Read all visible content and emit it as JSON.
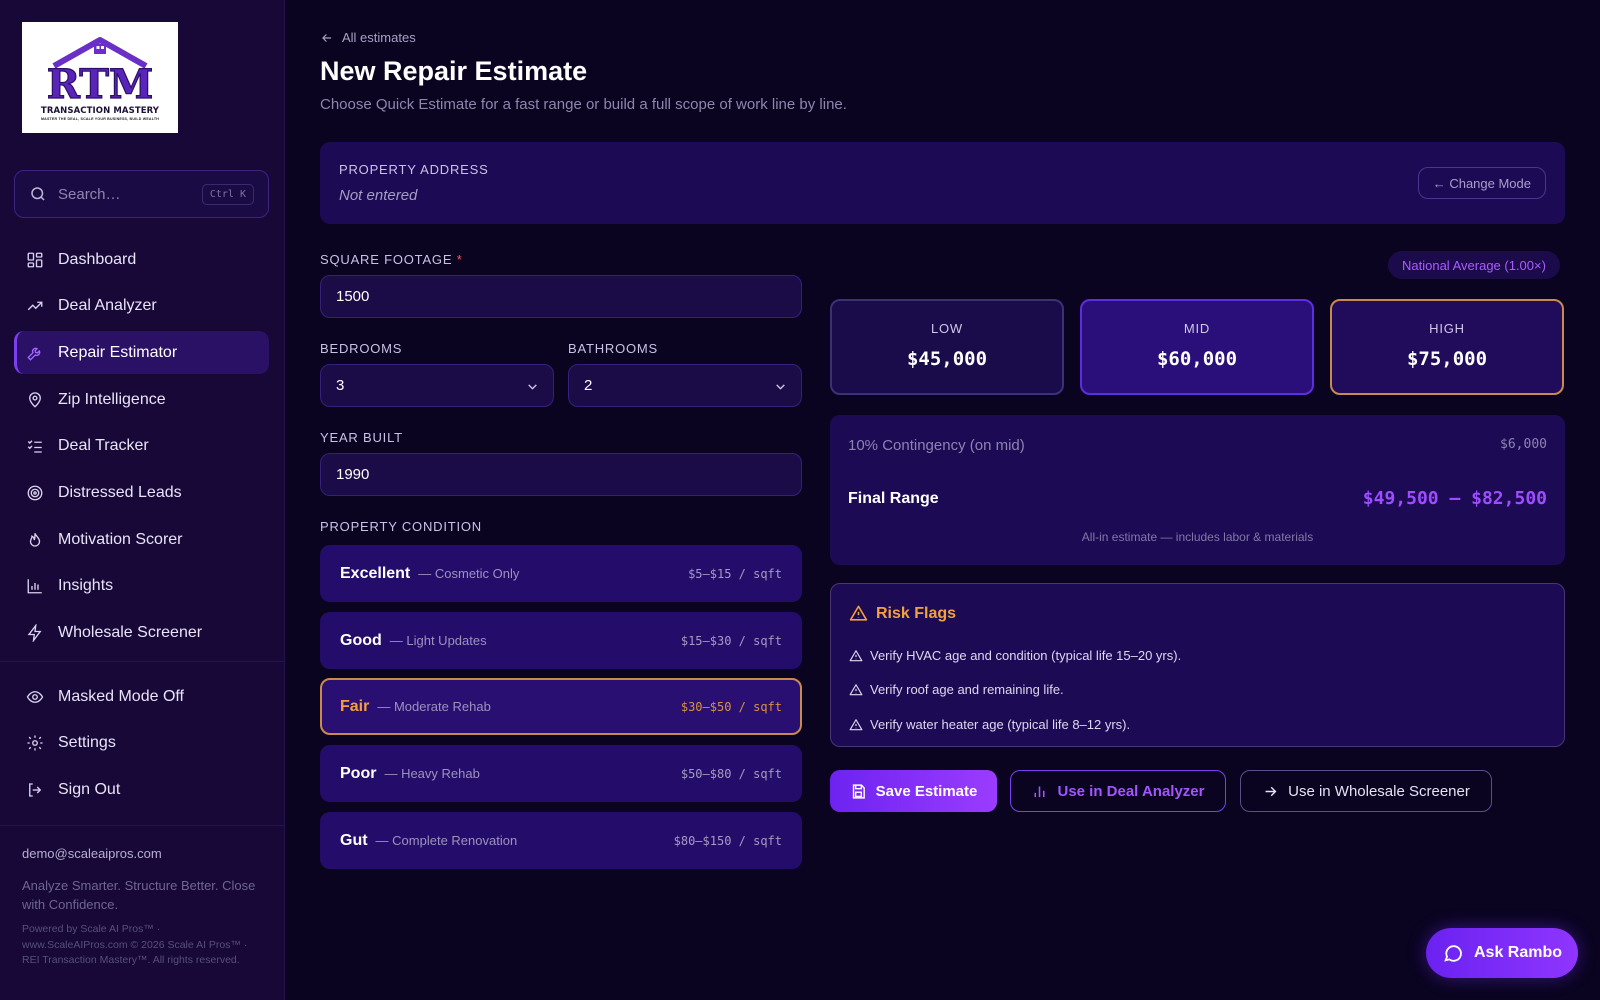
{
  "brand": {
    "logo_letters": "RTM",
    "logo_title": "TRANSACTION MASTERY",
    "logo_tagline": "MASTER THE DEAL, SCALE YOUR BUSINESS, BUILD WEALTH"
  },
  "search": {
    "placeholder": "Search…",
    "shortcut": "Ctrl K"
  },
  "sidebar": {
    "items": [
      {
        "label": "Dashboard",
        "icon": "grid-icon"
      },
      {
        "label": "Deal Analyzer",
        "icon": "trending-up-icon"
      },
      {
        "label": "Repair Estimator",
        "icon": "wrench-icon",
        "active": true
      },
      {
        "label": "Zip Intelligence",
        "icon": "map-pin-icon"
      },
      {
        "label": "Deal Tracker",
        "icon": "checklist-icon"
      },
      {
        "label": "Distressed Leads",
        "icon": "target-icon"
      },
      {
        "label": "Motivation Scorer",
        "icon": "flame-icon"
      },
      {
        "label": "Insights",
        "icon": "bar-chart-icon"
      },
      {
        "label": "Wholesale Screener",
        "icon": "lightning-icon"
      }
    ],
    "secondary": [
      {
        "label": "Masked Mode Off",
        "icon": "eye-icon"
      },
      {
        "label": "Settings",
        "icon": "gear-icon"
      },
      {
        "label": "Sign Out",
        "icon": "sign-out-icon"
      }
    ],
    "email": "demo@scaleaipros.com",
    "tagline": "Analyze Smarter. Structure Better. Close with Confidence.",
    "footer": "Powered by Scale AI Pros™ · www.ScaleAIPros.com © 2026 Scale AI Pros™ · REI Transaction Mastery™. All rights reserved."
  },
  "header": {
    "back_label": "All estimates",
    "title": "New Repair Estimate",
    "subtitle": "Choose Quick Estimate for a fast range or build a full scope of work line by line."
  },
  "address": {
    "label": "PROPERTY ADDRESS",
    "value": "Not entered",
    "change_mode_label": "← Change Mode"
  },
  "form": {
    "sqft_label": "SQUARE FOOTAGE",
    "sqft_required": "*",
    "sqft_value": "1500",
    "bedrooms_label": "BEDROOMS",
    "bedrooms_value": "3",
    "bathrooms_label": "BATHROOMS",
    "bathrooms_value": "2",
    "year_label": "YEAR BUILT",
    "year_value": "1990",
    "condition_label": "PROPERTY CONDITION"
  },
  "conditions": [
    {
      "name": "Excellent",
      "desc": "— Cosmetic Only",
      "price": "$5–$15 / sqft"
    },
    {
      "name": "Good",
      "desc": "— Light Updates",
      "price": "$15–$30 / sqft"
    },
    {
      "name": "Fair",
      "desc": "— Moderate Rehab",
      "price": "$30–$50 / sqft",
      "selected": true
    },
    {
      "name": "Poor",
      "desc": "— Heavy Rehab",
      "price": "$50–$80 / sqft"
    },
    {
      "name": "Gut",
      "desc": "— Complete Renovation",
      "price": "$80–$150 / sqft"
    }
  ],
  "region_badge": "National Average (1.00×)",
  "estimates": {
    "low": {
      "label": "LOW",
      "value": "$45,000"
    },
    "mid": {
      "label": "MID",
      "value": "$60,000"
    },
    "high": {
      "label": "HIGH",
      "value": "$75,000"
    }
  },
  "range": {
    "contingency_label": "10% Contingency (on mid)",
    "contingency_value": "$6,000",
    "final_label": "Final Range",
    "final_value": "$49,500 – $82,500",
    "note": "All-in estimate — includes labor & materials"
  },
  "risk": {
    "title": "Risk Flags",
    "items": [
      "Verify HVAC age and condition (typical life 15–20 yrs).",
      "Verify roof age and remaining life.",
      "Verify water heater age (typical life 8–12 yrs)."
    ]
  },
  "actions": {
    "save": "Save Estimate",
    "deal": "Use in Deal Analyzer",
    "wholesale": "Use in Wholesale Screener"
  },
  "assistant": {
    "label": "Ask Rambo"
  },
  "colors": {
    "background": "#0a0420",
    "sidebar": "#170838",
    "accent": "#7b3ff0",
    "warning": "#f2a13c"
  }
}
